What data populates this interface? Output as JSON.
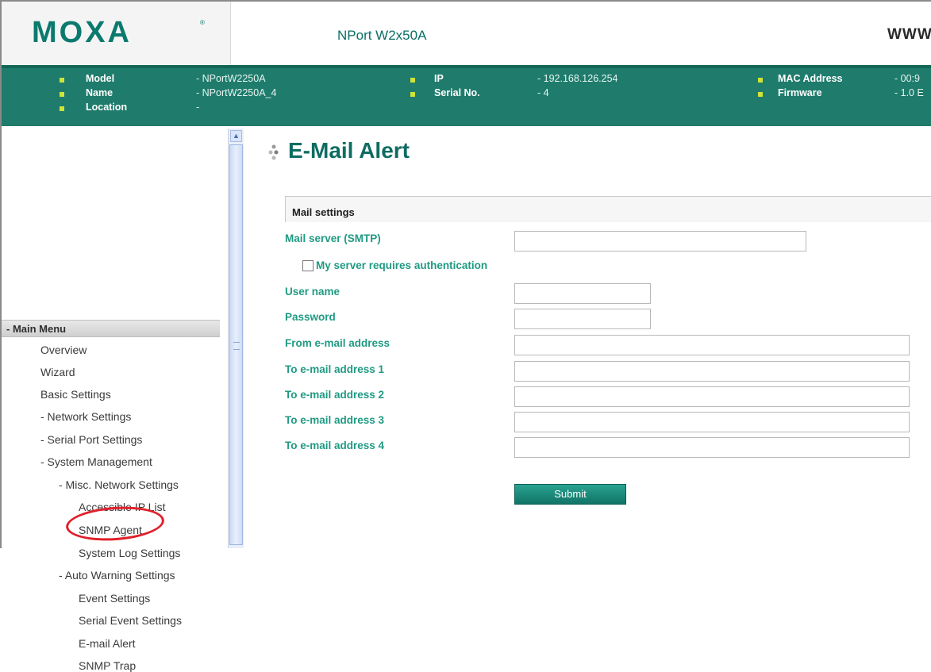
{
  "header": {
    "logo_text": "MOXA",
    "logo_mark": "®",
    "product": "NPort W2x50A",
    "site_prefix": "WWW"
  },
  "info": {
    "model_label": "Model",
    "model_value": "- NPortW2250A",
    "name_label": "Name",
    "name_value": "- NPortW2250A_4",
    "location_label": "Location",
    "location_value": "-",
    "ip_label": "IP",
    "ip_value": "- 192.168.126.254",
    "serial_label": "Serial No.",
    "serial_value": "- 4",
    "mac_label": "MAC Address",
    "mac_value": "- 00:9",
    "firmware_label": "Firmware",
    "firmware_value": "- 1.0 E"
  },
  "sidebar": {
    "menu_header": "- Main Menu",
    "items": [
      "Overview",
      "Wizard",
      "Basic Settings",
      "- Network Settings",
      "- Serial Port Settings",
      "- System Management",
      "- Misc. Network Settings",
      "Accessible IP List",
      "SNMP Agent",
      "System Log Settings",
      "- Auto Warning Settings",
      "Event Settings",
      "Serial Event Settings",
      "E-mail Alert",
      "SNMP Trap"
    ]
  },
  "main": {
    "title": "E-Mail Alert",
    "section_title": "Mail settings",
    "labels": {
      "smtp": "Mail server (SMTP)",
      "auth": "My server requires authentication",
      "user": "User name",
      "password": "Password",
      "from": "From e-mail address",
      "to1": "To e-mail address 1",
      "to2": "To e-mail address 2",
      "to3": "To e-mail address 3",
      "to4": "To e-mail address 4"
    },
    "values": {
      "smtp": "",
      "user": "",
      "password": "",
      "from": "",
      "to1": "",
      "to2": "",
      "to3": "",
      "to4": ""
    },
    "auth_checked": false,
    "submit_label": "Submit"
  },
  "colors": {
    "brand": "#0b7a6e",
    "info_bar": "#1f7c6c",
    "bullet": "#cfe33a",
    "label_green": "#1f9a82",
    "highlight": "#e0202a"
  },
  "icons": {
    "title_icon": "dots-icon",
    "scroll_up": "chevron-up-icon"
  }
}
